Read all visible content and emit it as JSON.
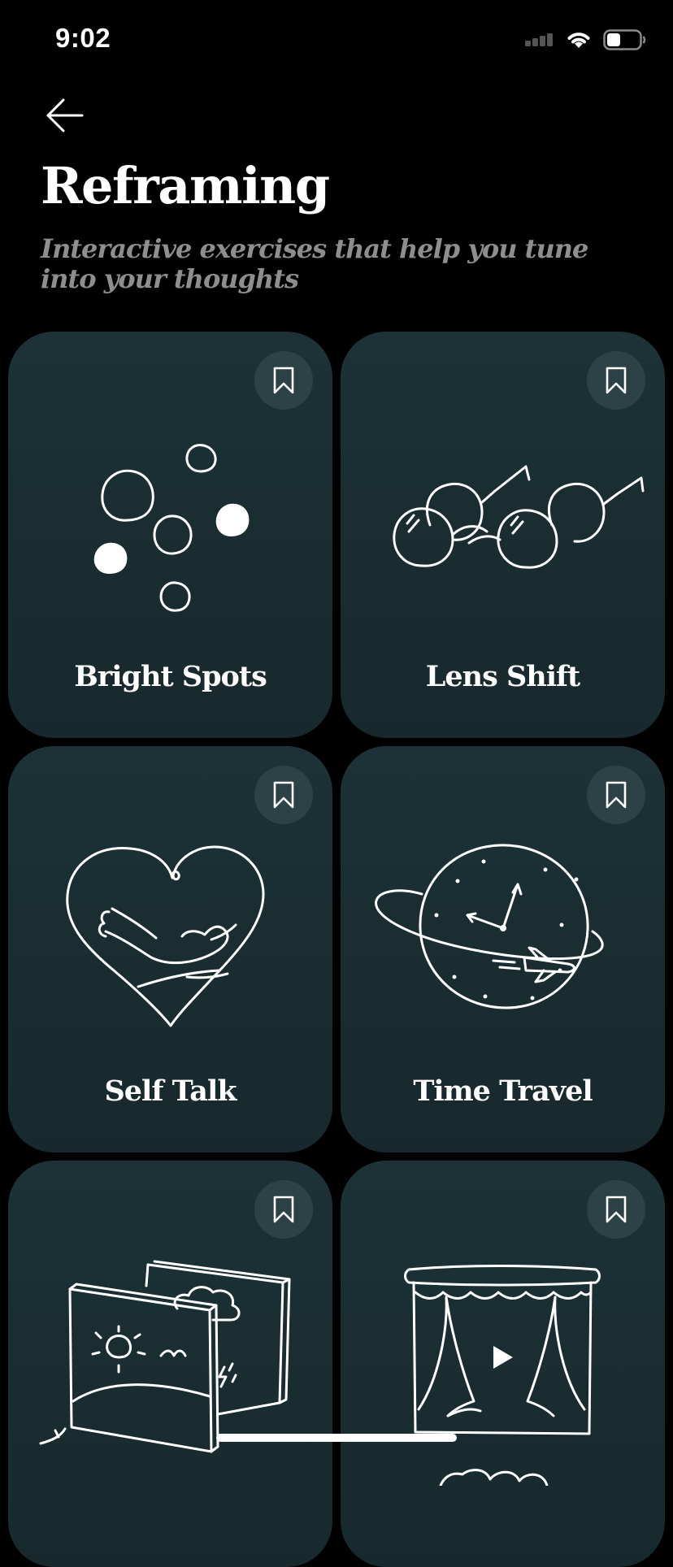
{
  "status_bar": {
    "time": "9:02"
  },
  "header": {
    "back_icon": "arrow-left-icon",
    "title": "Reframing",
    "subtitle": "Interactive exercises that help you tune into your thoughts"
  },
  "colors": {
    "background": "#000000",
    "card_background": "#1a2f33",
    "bookmark_background": "#2c4246",
    "subtitle": "#8e8e8e"
  },
  "cards": [
    {
      "label": "Bright Spots",
      "icon": "dots-icon"
    },
    {
      "label": "Lens Shift",
      "icon": "glasses-icon"
    },
    {
      "label": "Self Talk",
      "icon": "heart-hug-icon"
    },
    {
      "label": "Time Travel",
      "icon": "clock-planet-icon"
    },
    {
      "label": "",
      "icon": "weather-frames-icon"
    },
    {
      "label": "",
      "icon": "theater-icon"
    }
  ]
}
